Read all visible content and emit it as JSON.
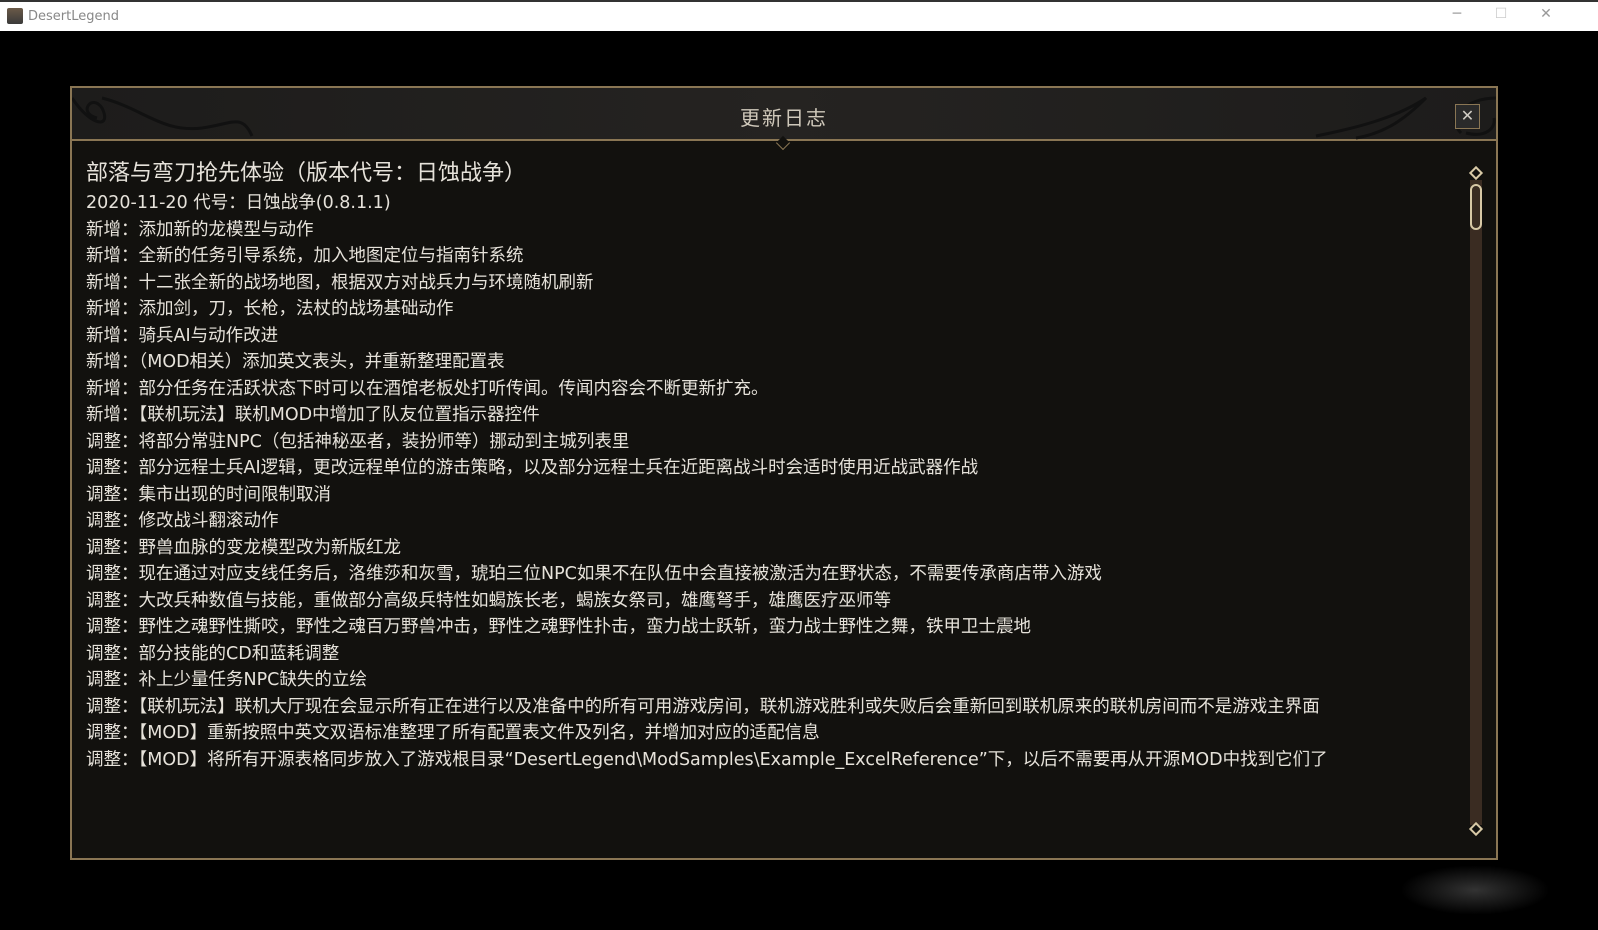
{
  "window": {
    "title": "DesertLegend",
    "minimize": "─",
    "maximize": "☐",
    "close": "✕"
  },
  "dialog": {
    "title": "更新日志",
    "close_label": "✕"
  },
  "changelog": {
    "heading": "部落与弯刀抢先体验（版本代号：日蚀战争）",
    "lines": [
      "2020-11-20 代号：日蚀战争(0.8.1.1)",
      "新增：添加新的龙模型与动作",
      "新增：全新的任务引导系统，加入地图定位与指南针系统",
      "新增：十二张全新的战场地图，根据双方对战兵力与环境随机刷新",
      "新增：添加剑，刀，长枪，法杖的战场基础动作",
      "新增：骑兵AI与动作改进",
      "新增：（MOD相关）添加英文表头，并重新整理配置表",
      "新增：部分任务在活跃状态下时可以在酒馆老板处打听传闻。传闻内容会不断更新扩充。",
      "新增：【联机玩法】联机MOD中增加了队友位置指示器控件",
      "调整：将部分常驻NPC（包括神秘巫者，装扮师等）挪动到主城列表里",
      "调整：部分远程士兵AI逻辑，更改远程单位的游击策略，以及部分远程士兵在近距离战斗时会适时使用近战武器作战",
      "调整：集市出现的时间限制取消",
      "调整：修改战斗翻滚动作",
      "调整：野兽血脉的变龙模型改为新版红龙",
      "调整：现在通过对应支线任务后，洛维莎和灰雪，琥珀三位NPC如果不在队伍中会直接被激活为在野状态，不需要传承商店带入游戏",
      "调整：大改兵种数值与技能，重做部分高级兵特性如蝎族长老，蝎族女祭司，雄鹰弩手，雄鹰医疗巫师等",
      "调整：野性之魂野性撕咬，野性之魂百万野兽冲击，野性之魂野性扑击，蛮力战士跃斩，蛮力战士野性之舞，铁甲卫士震地",
      "调整：部分技能的CD和蓝耗调整",
      "调整：补上少量任务NPC缺失的立绘",
      "调整：【联机玩法】联机大厅现在会显示所有正在进行以及准备中的所有可用游戏房间，联机游戏胜利或失败后会重新回到联机原来的联机房间而不是游戏主界面",
      "调整：【MOD】重新按照中英文双语标准整理了所有配置表文件及列名，并增加对应的适配信息",
      "调整：【MOD】将所有开源表格同步放入了游戏根目录“DesertLegend\\ModSamples\\Example_ExcelReference”下，以后不需要再从开源MOD中找到它们了"
    ]
  },
  "scroll": {
    "position_fraction": 0.0
  }
}
